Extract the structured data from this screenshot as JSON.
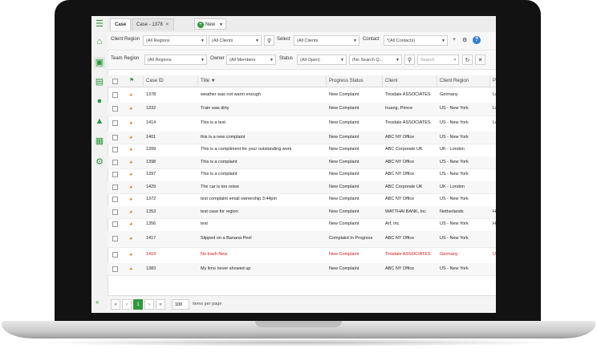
{
  "tabs": [
    {
      "label": "Case"
    },
    {
      "label": "Case - 1378"
    }
  ],
  "new_label": "New",
  "filters": {
    "client_region_label": "Client Region",
    "client_region_value": "(All Regions",
    "client_value": "(All Clients",
    "select_label": "Select",
    "select_value": "(All Clients",
    "contact_label": "Contact",
    "contact_value": "*(All Contacts)",
    "team_region_label": "Team Region",
    "team_region_value": "(All Regions",
    "owner_label": "Owner",
    "owner_value": "(All Members",
    "status_label": "Status",
    "status_value": "(All Open)",
    "saved_search_value": "(No Search Q...",
    "search_placeholder": "Search"
  },
  "columns": [
    "Case ID",
    "Title ▼",
    "Progress Status",
    "Client",
    "Client Region",
    "Priority"
  ],
  "rows": [
    {
      "id": "1378",
      "title": "weather was not warm enough",
      "status": "New Complaint",
      "client": "Tinsdale ASSOCIATES",
      "region": "Germany",
      "priority": "Low",
      "urgent": false
    },
    {
      "id": "1332",
      "title": "Train was dirty",
      "status": "New Complaint",
      "client": "Iruang, Prince",
      "region": "US - New York",
      "priority": "Low",
      "urgent": false
    },
    {
      "id": "1414",
      "title": "This is a test",
      "status": "New Complaint",
      "client": "Tinsdale ASSOCIATES",
      "region": "US - New York",
      "priority": "Low",
      "urgent": false
    },
    {
      "id": "1401",
      "title": "this is a new complaint",
      "status": "New Complaint",
      "client": "ABC NY Office",
      "region": "US - New York",
      "priority": "",
      "urgent": false
    },
    {
      "id": "1399",
      "title": "This is a compliment for your outstanding work",
      "status": "New Complaint",
      "client": "ABC Corporate UK",
      "region": "UK - London",
      "priority": "",
      "urgent": false
    },
    {
      "id": "1398",
      "title": "This is a complaint",
      "status": "New Complaint",
      "client": "ABC NY Office",
      "region": "US - New York",
      "priority": "",
      "urgent": false
    },
    {
      "id": "1397",
      "title": "This is a complaint",
      "status": "New Complaint",
      "client": "ABC NY Office",
      "region": "US - New York",
      "priority": "",
      "urgent": false
    },
    {
      "id": "1429",
      "title": "The car is too noise",
      "status": "New Complaint",
      "client": "ABC Corporate UK",
      "region": "UK - London",
      "priority": "",
      "urgent": false
    },
    {
      "id": "1372",
      "title": "test complaint email ownership 3:44pm",
      "status": "New Complaint",
      "client": "ABC NY Office",
      "region": "US - New York",
      "priority": "",
      "urgent": false
    },
    {
      "id": "1353",
      "title": "test case for region",
      "status": "New Complaint",
      "client": "WATTHAI BANK, Inc",
      "region": "Netherlands",
      "priority": "High",
      "urgent": false
    },
    {
      "id": "1356",
      "title": "test",
      "status": "New Complaint",
      "client": "Arf, Inc",
      "region": "US - New York",
      "priority": "High",
      "urgent": false
    },
    {
      "id": "1417",
      "title": "Slipped on a Banana Peel",
      "status": "Complaint In Progress",
      "client": "ABC NY Office",
      "region": "US - New York",
      "priority": "",
      "urgent": false
    },
    {
      "id": "1419",
      "title": "No trash New",
      "status": "New Complaint",
      "client": "Tinsdale ASSOCIATES",
      "region": "Germany",
      "priority": "Urgent",
      "urgent": true
    },
    {
      "id": "1383",
      "title": "My limo never showed up",
      "status": "New Complaint",
      "client": "ABC NY Office",
      "region": "US - New York",
      "priority": "",
      "urgent": false
    }
  ],
  "pager": {
    "current_page": "1",
    "per_page": "100",
    "per_page_label": "items per page"
  },
  "colors": {
    "accent": "#2e9b3a",
    "urgent": "#e01515"
  }
}
